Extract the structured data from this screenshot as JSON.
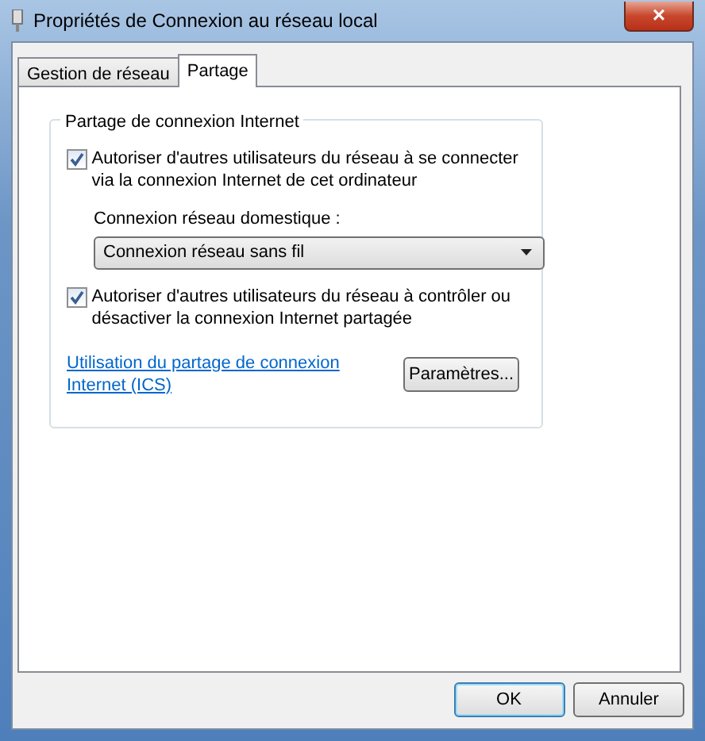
{
  "window": {
    "title": "Propriétés de Connexion au réseau local",
    "close": "×"
  },
  "tabs": [
    {
      "label": "Gestion de réseau",
      "selected": false
    },
    {
      "label": "Partage",
      "selected": true
    }
  ],
  "group": {
    "title": "Partage de connexion Internet",
    "allow_connect": {
      "label": "Autoriser d'autres utilisateurs du réseau à se connecter via la connexion Internet de cet ordinateur",
      "checked": true
    },
    "home_network": {
      "label": "Connexion réseau domestique :",
      "value": "Connexion réseau sans fil"
    },
    "allow_control": {
      "label": "Autoriser d'autres utilisateurs du réseau à contrôler ou désactiver la connexion Internet partagée",
      "checked": true
    },
    "link": "Utilisation du partage de connexion Internet (ICS)",
    "settings_button": "Paramètres..."
  },
  "buttons": [
    {
      "label": "OK",
      "default": true
    },
    {
      "label": "Annuler",
      "default": false
    }
  ]
}
